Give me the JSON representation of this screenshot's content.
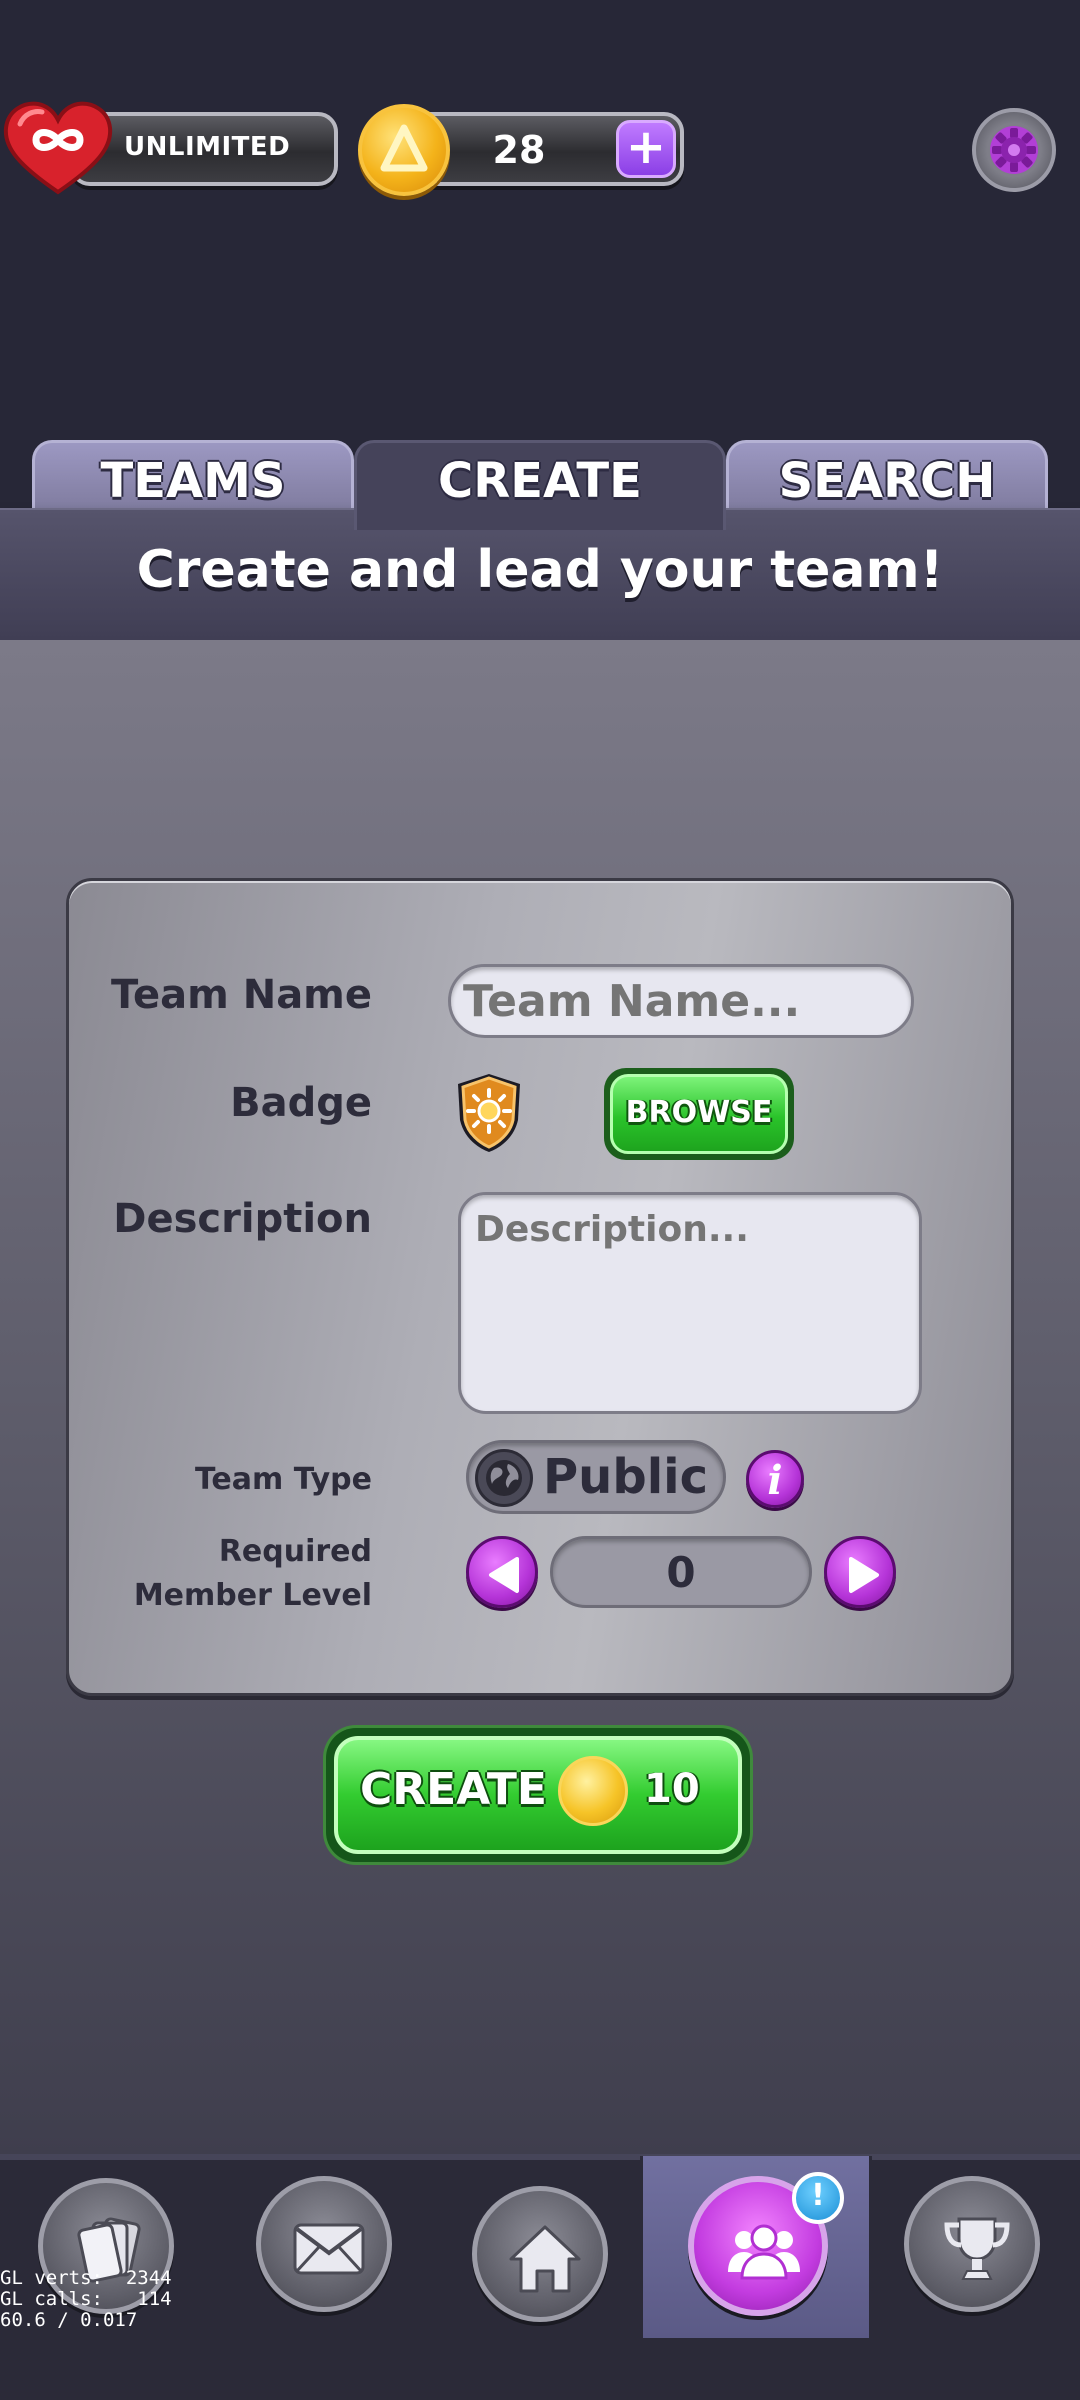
{
  "hud": {
    "lives_label": "UNLIMITED",
    "coins_value": "28",
    "plus_label": "+",
    "lives_icon": "infinity-heart-icon",
    "coin_icon": "coin-icon",
    "settings_icon": "gear-icon"
  },
  "tabs": [
    {
      "label": "TEAMS",
      "active": false
    },
    {
      "label": "CREATE",
      "active": true
    },
    {
      "label": "SEARCH",
      "active": false
    }
  ],
  "banner": {
    "title": "Create and lead your team!"
  },
  "form": {
    "team_name_label": "Team Name",
    "team_name_placeholder": "Team Name...",
    "team_name_value": "",
    "badge_label": "Badge",
    "badge_icon": "sun-shield-icon",
    "browse_label": "BROWSE",
    "description_label": "Description",
    "description_placeholder": "Description...",
    "description_value": "",
    "team_type_label": "Team Type",
    "team_type_value": "Public",
    "info_label": "i",
    "required_level_label_line1": "Required",
    "required_level_label_line2": "Member Level",
    "required_level_value": "0"
  },
  "create_button": {
    "label": "CREATE",
    "cost": "10"
  },
  "bottom_nav": {
    "items": [
      {
        "icon": "cards-icon",
        "active": false
      },
      {
        "icon": "mail-icon",
        "active": false
      },
      {
        "icon": "home-icon",
        "active": false
      },
      {
        "icon": "team-icon",
        "active": true
      },
      {
        "icon": "trophy-icon",
        "active": false
      }
    ],
    "notification_badge": "!"
  },
  "debug": {
    "line1": "GL verts:  2344",
    "line2": "GL calls:   114",
    "line3": "60.6 / 0.017"
  },
  "colors": {
    "background": "#272737",
    "accent_purple": "#b534d8",
    "accent_green": "#2ac32a",
    "coin_gold": "#f4b31a"
  }
}
